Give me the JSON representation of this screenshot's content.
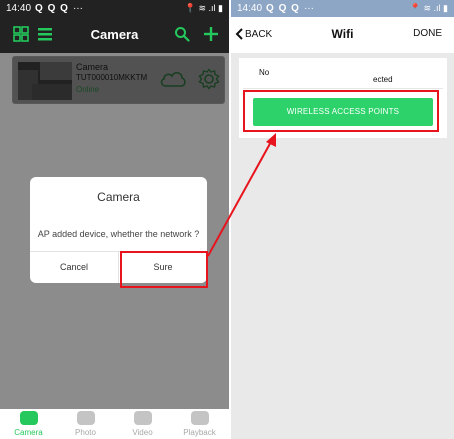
{
  "left_screen": {
    "status_bar": {
      "time": "14:40",
      "notifications": "Q Q Q",
      "more": "···",
      "system": "📍 ≋ .ıl ▮"
    },
    "header": {
      "title": "Camera"
    },
    "camera": {
      "name": "Camera",
      "id": "TUT000010MKKTM",
      "status": "Online"
    },
    "dialog": {
      "title": "Camera",
      "message": "AP added device, whether the network ?",
      "cancel_label": "Cancel",
      "confirm_label": "Sure"
    },
    "tabs": [
      {
        "label": "Camera",
        "active": true
      },
      {
        "label": "Photo",
        "active": false
      },
      {
        "label": "Video",
        "active": false
      },
      {
        "label": "Playback",
        "active": false
      }
    ]
  },
  "right_screen": {
    "status_bar": {
      "time": "14:40",
      "notifications": "Q Q Q",
      "more": "···",
      "system": "📍 ≋ .ıl ▮"
    },
    "nav": {
      "back_label": "BACK",
      "title": "Wifi",
      "done_label": "DONE"
    },
    "wifi": {
      "status_prefix": "No",
      "status_suffix": "ected",
      "button_label": "WIRELESS ACCESS POINTS"
    }
  },
  "colors": {
    "accent_green": "#24c85c",
    "highlight_red": "#e8141d"
  }
}
